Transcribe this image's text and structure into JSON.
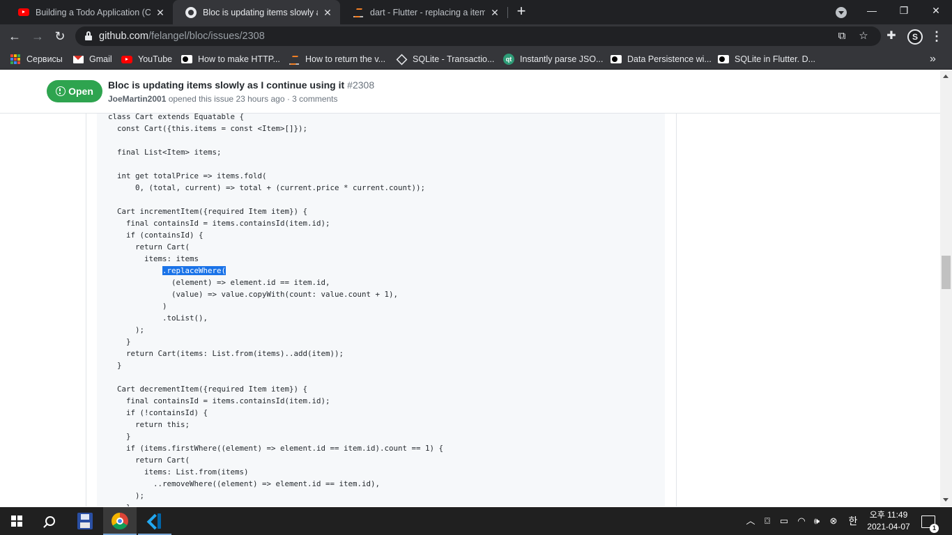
{
  "browser": {
    "tabs": [
      {
        "title": "Building a Todo Application (CRU",
        "icon": "youtube-icon",
        "active": false
      },
      {
        "title": "Bloc is updating items slowly as I",
        "icon": "github-icon",
        "active": true
      },
      {
        "title": "dart - Flutter - replacing a item in",
        "icon": "stackoverflow-icon",
        "active": false
      }
    ],
    "new_tab": "+",
    "window_controls": {
      "minimize": "—",
      "maximize": "❐",
      "close": "✕"
    },
    "address": {
      "host": "github.com",
      "path": "/felangel/bloc/issues/2308"
    },
    "profile_letter": "S",
    "bookmarks": [
      {
        "label": "Сервисы",
        "icon": "apps-icon"
      },
      {
        "label": "Gmail",
        "icon": "gmail-icon"
      },
      {
        "label": "YouTube",
        "icon": "youtube-icon"
      },
      {
        "label": "How to make HTTP...",
        "icon": "medium-icon"
      },
      {
        "label": "How to return the v...",
        "icon": "stackoverflow-icon"
      },
      {
        "label": "SQLite - Transactio...",
        "icon": "sqlite-icon"
      },
      {
        "label": "Instantly parse JSO...",
        "icon": "quicktype-icon"
      },
      {
        "label": "Data Persistence wi...",
        "icon": "medium-icon"
      },
      {
        "label": "SQLite in Flutter. D...",
        "icon": "medium-icon"
      }
    ],
    "bookmarks_more": "»"
  },
  "issue": {
    "state": "Open",
    "title": "Bloc is updating items slowly as I continue using it",
    "number": "#2308",
    "author": "JoeMartin2001",
    "meta": " opened this issue 23 hours ago · 3 comments"
  },
  "code_lines": [
    {
      "pre": "class Cart extends Equatable {"
    },
    {
      "pre": "  const Cart({this.items = const <Item>[]});"
    },
    {
      "pre": ""
    },
    {
      "pre": "  final List<Item> items;"
    },
    {
      "pre": ""
    },
    {
      "pre": "  int get totalPrice => items.fold("
    },
    {
      "pre": "      0, (total, current) => total + (current.price * current.count));"
    },
    {
      "pre": ""
    },
    {
      "pre": "  Cart incrementItem({required Item item}) {"
    },
    {
      "pre": "    final containsId = items.containsId(item.id);"
    },
    {
      "pre": "    if (containsId) {"
    },
    {
      "pre": "      return Cart("
    },
    {
      "pre": "        items: items"
    },
    {
      "pre": "            ",
      "sel": ".replaceWhere("
    },
    {
      "pre": "              (element) => element.id == item.id,"
    },
    {
      "pre": "              (value) => value.copyWith(count: value.count + 1),"
    },
    {
      "pre": "            )"
    },
    {
      "pre": "            .toList(),"
    },
    {
      "pre": "      );"
    },
    {
      "pre": "    }"
    },
    {
      "pre": "    return Cart(items: List.from(items)..add(item));"
    },
    {
      "pre": "  }"
    },
    {
      "pre": ""
    },
    {
      "pre": "  Cart decrementItem({required Item item}) {"
    },
    {
      "pre": "    final containsId = items.containsId(item.id);"
    },
    {
      "pre": "    if (!containsId) {"
    },
    {
      "pre": "      return this;"
    },
    {
      "pre": "    }"
    },
    {
      "pre": "    if (items.firstWhere((element) => element.id == item.id).count == 1) {"
    },
    {
      "pre": "      return Cart("
    },
    {
      "pre": "        items: List.from(items)"
    },
    {
      "pre": "          ..removeWhere((element) => element.id == item.id),"
    },
    {
      "pre": "      );"
    },
    {
      "pre": "    }"
    }
  ],
  "taskbar": {
    "clock_time": "오후 11:49",
    "clock_date": "2021-04-07",
    "ime": "한",
    "notifications": "1"
  },
  "colors": {
    "open_badge": "#2ea44f",
    "selection": "#1a73e8",
    "chrome_dark": "#202124"
  }
}
